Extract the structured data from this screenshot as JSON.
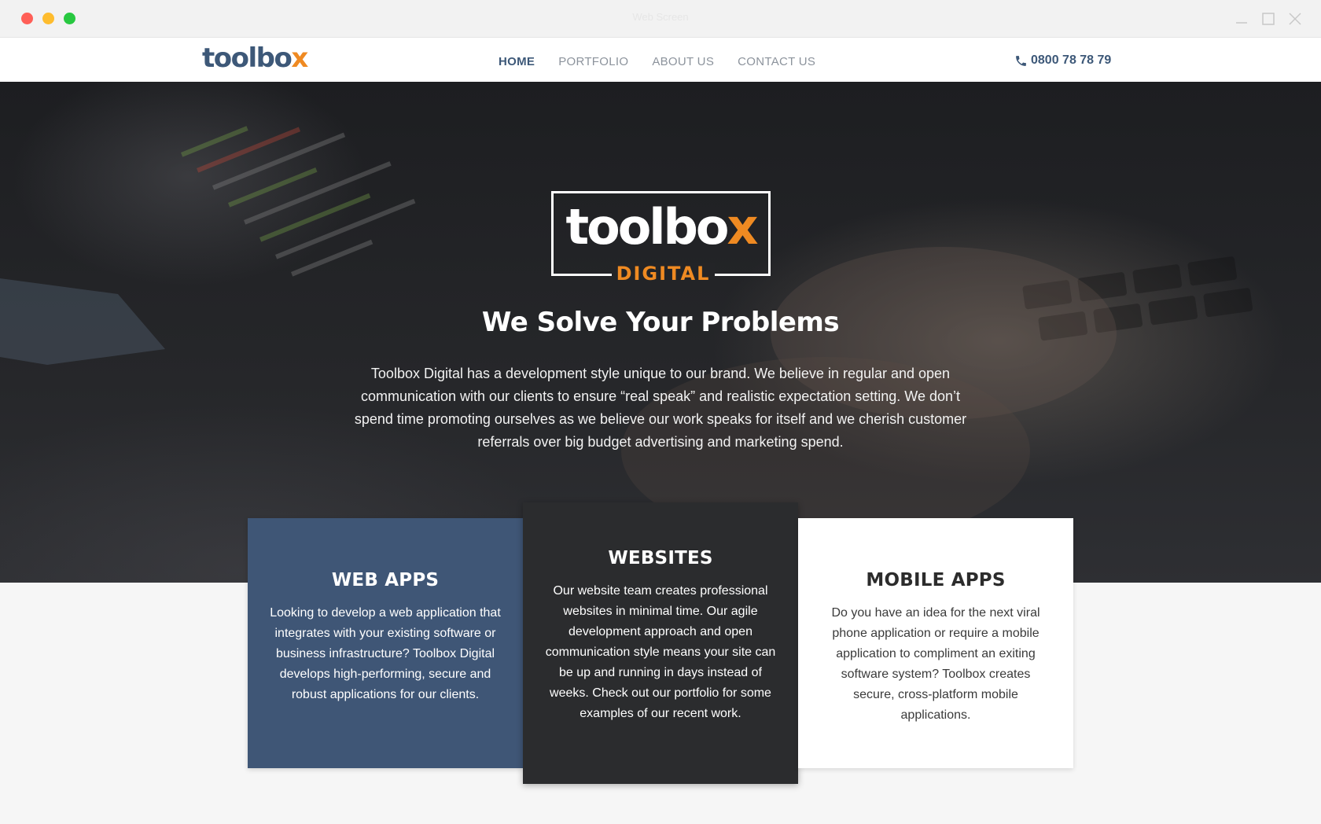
{
  "window": {
    "title": "Web Screen"
  },
  "nav": {
    "logo_main": "toolbo",
    "logo_accent": "x",
    "links": [
      "HOME",
      "PORTFOLIO",
      "ABOUT US",
      "CONTACT US"
    ],
    "active": "HOME",
    "phone": "0800 78 78 79",
    "phone_icon": "phone-icon"
  },
  "hero": {
    "logo_main": "toolbo",
    "logo_accent": "x",
    "logo_sub": "DIGITAL",
    "title": "We Solve Your Problems",
    "text": "Toolbox Digital has a development style unique to our brand. We believe in regular and open communication with our clients to ensure “real speak” and realistic expectation setting. We don’t spend time promoting ourselves as we believe our work speaks for itself and we cherish customer referrals over big budget advertising and marketing spend."
  },
  "cards": [
    {
      "title": "WEB APPS",
      "text": "Looking to develop a web application that integrates with your existing software or business infrastructure? Toolbox Digital develops high-performing, secure and robust applications for our clients."
    },
    {
      "title": "WEBSITES",
      "text": "Our website team creates professional websites in minimal time. Our agile development approach and open communication style means your site can be up and running in days instead of weeks. Check out our portfolio for some examples of our recent work."
    },
    {
      "title": "MOBILE APPS",
      "text": "Do you have an idea for the next viral phone application or require a mobile application to compliment an exiting software system? Toolbox creates secure, cross-platform mobile applications."
    }
  ],
  "colors": {
    "brand_blue": "#3d5878",
    "brand_orange": "#ef8a22",
    "card_blue": "#3f5676",
    "card_dark": "#2b2c2e"
  }
}
